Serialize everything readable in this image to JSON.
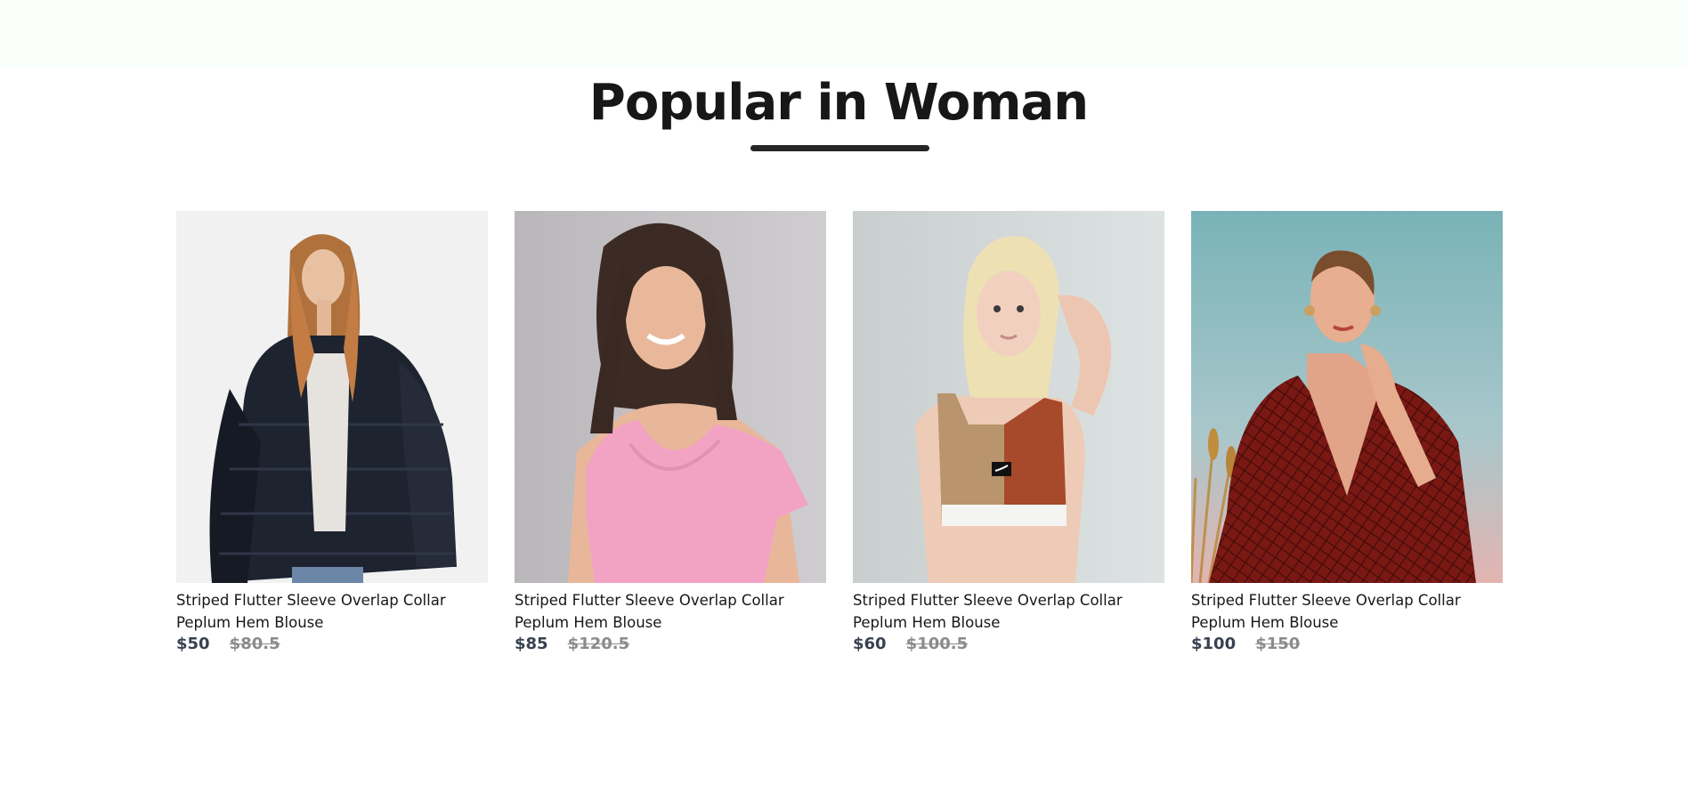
{
  "section": {
    "title": "Popular in Woman"
  },
  "products": [
    {
      "name": "Striped Flutter Sleeve Overlap Collar Peplum Hem Blouse",
      "price_new": "$50",
      "price_old": "$80.5",
      "image": "woman-black-fur-jacket-photo"
    },
    {
      "name": "Striped Flutter Sleeve Overlap Collar Peplum Hem Blouse",
      "price_new": "$85",
      "price_old": "$120.5",
      "image": "woman-pink-top-photo"
    },
    {
      "name": "Striped Flutter Sleeve Overlap Collar Peplum Hem Blouse",
      "price_new": "$60",
      "price_old": "$100.5",
      "image": "woman-sports-crop-top-photo"
    },
    {
      "name": "Striped Flutter Sleeve Overlap Collar Peplum Hem Blouse",
      "price_new": "$100",
      "price_old": "$150",
      "image": "woman-red-patterned-dress-photo"
    }
  ],
  "colors": {
    "top_band": "#fbfffb",
    "title": "#171717",
    "underline": "#252525",
    "price_new": "#374151",
    "price_old": "#8b8b8b"
  }
}
